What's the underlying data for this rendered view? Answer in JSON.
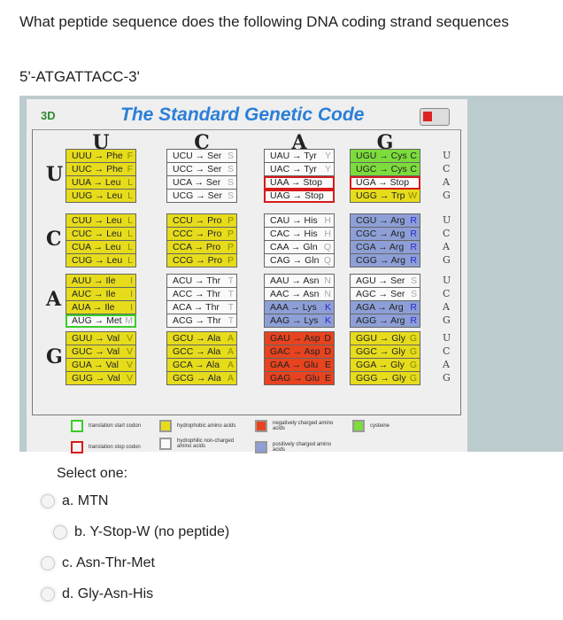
{
  "question": "What peptide sequence does the following DNA coding strand sequences",
  "dna": "5'-ATGATTACC-3'",
  "table": {
    "logo": "3D",
    "title": "The Standard Genetic Code",
    "columns": [
      "U",
      "C",
      "A",
      "G"
    ],
    "third": [
      "U",
      "C",
      "A",
      "G"
    ],
    "rows": [
      {
        "first": "U",
        "blocks": [
          [
            [
              "UUU → Phe",
              "F",
              "y"
            ],
            [
              "UUC → Phe",
              "F",
              "y"
            ],
            [
              "UUA → Leu",
              "L",
              "y"
            ],
            [
              "UUG → Leu",
              "L",
              "y"
            ]
          ],
          [
            [
              "UCU → Ser",
              "S",
              "w"
            ],
            [
              "UCC → Ser",
              "S",
              "w"
            ],
            [
              "UCA → Ser",
              "S",
              "w"
            ],
            [
              "UCG → Ser",
              "S",
              "w"
            ]
          ],
          [
            [
              "UAU → Tyr",
              "Y",
              "w"
            ],
            [
              "UAC → Tyr",
              "Y",
              "w"
            ],
            [
              "UAA → Stop",
              "",
              "w stop"
            ],
            [
              "UAG → Stop",
              "",
              "w stop"
            ]
          ],
          [
            [
              "UGU → Cys",
              "C",
              "g"
            ],
            [
              "UGC → Cys",
              "C",
              "g"
            ],
            [
              "UGA → Stop",
              "",
              "w stop"
            ],
            [
              "UGG → Trp",
              "W",
              "y"
            ]
          ]
        ]
      },
      {
        "first": "C",
        "blocks": [
          [
            [
              "CUU → Leu",
              "L",
              "y"
            ],
            [
              "CUC → Leu",
              "L",
              "y"
            ],
            [
              "CUA → Leu",
              "L",
              "y"
            ],
            [
              "CUG → Leu",
              "L",
              "y"
            ]
          ],
          [
            [
              "CCU → Pro",
              "P",
              "y"
            ],
            [
              "CCC → Pro",
              "P",
              "y"
            ],
            [
              "CCA → Pro",
              "P",
              "y"
            ],
            [
              "CCG → Pro",
              "P",
              "y"
            ]
          ],
          [
            [
              "CAU → His",
              "H",
              "w"
            ],
            [
              "CAC → His",
              "H",
              "w"
            ],
            [
              "CAA → Gln",
              "Q",
              "w"
            ],
            [
              "CAG → Gln",
              "Q",
              "w"
            ]
          ],
          [
            [
              "CGU → Arg",
              "R",
              "b"
            ],
            [
              "CGC → Arg",
              "R",
              "b"
            ],
            [
              "CGA → Arg",
              "R",
              "b"
            ],
            [
              "CGG → Arg",
              "R",
              "b"
            ]
          ]
        ]
      },
      {
        "first": "A",
        "blocks": [
          [
            [
              "AUU → Ile",
              "I",
              "y"
            ],
            [
              "AUC → Ile",
              "I",
              "y"
            ],
            [
              "AUA → Ile",
              "I",
              "y"
            ],
            [
              "AUG → Met",
              "M",
              "w start"
            ]
          ],
          [
            [
              "ACU → Thr",
              "T",
              "w"
            ],
            [
              "ACC → Thr",
              "T",
              "w"
            ],
            [
              "ACA → Thr",
              "T",
              "w"
            ],
            [
              "ACG → Thr",
              "T",
              "w"
            ]
          ],
          [
            [
              "AAU → Asn",
              "N",
              "w"
            ],
            [
              "AAC → Asn",
              "N",
              "w"
            ],
            [
              "AAA → Lys",
              "K",
              "b"
            ],
            [
              "AAG → Lys",
              "K",
              "b"
            ]
          ],
          [
            [
              "AGU → Ser",
              "S",
              "w"
            ],
            [
              "AGC → Ser",
              "S",
              "w"
            ],
            [
              "AGA → Arg",
              "R",
              "b"
            ],
            [
              "AGG → Arg",
              "R",
              "b"
            ]
          ]
        ]
      },
      {
        "first": "G",
        "blocks": [
          [
            [
              "GUU → Val",
              "V",
              "y"
            ],
            [
              "GUC → Val",
              "V",
              "y"
            ],
            [
              "GUA → Val",
              "V",
              "y"
            ],
            [
              "GUG → Val",
              "V",
              "y"
            ]
          ],
          [
            [
              "GCU → Ala",
              "A",
              "y"
            ],
            [
              "GCC → Ala",
              "A",
              "y"
            ],
            [
              "GCA → Ala",
              "A",
              "y"
            ],
            [
              "GCG → Ala",
              "A",
              "y"
            ]
          ],
          [
            [
              "GAU → Asp",
              "D",
              "r"
            ],
            [
              "GAC → Asp",
              "D",
              "r"
            ],
            [
              "GAA → Glu",
              "E",
              "r"
            ],
            [
              "GAG → Glu",
              "E",
              "r"
            ]
          ],
          [
            [
              "GGU → Gly",
              "G",
              "y"
            ],
            [
              "GGC → Gly",
              "G",
              "y"
            ],
            [
              "GGA → Gly",
              "G",
              "y"
            ],
            [
              "GGG → Gly",
              "G",
              "y"
            ]
          ]
        ]
      }
    ],
    "legend": [
      {
        "label": "translation start codon",
        "color": "#3bcc2a",
        "fill": "#f4f4f4"
      },
      {
        "label": "translation stop codon",
        "color": "#d81a1a",
        "fill": "#f4f4f4"
      },
      {
        "label": "hydrophobic amino acids",
        "color": "#999999",
        "fill": "#e6dc1c"
      },
      {
        "label": "hydrophilic non-charged amino acids",
        "color": "#999999",
        "fill": "#fafafa"
      },
      {
        "label": "negatively charged amino acids",
        "color": "#999999",
        "fill": "#e7431f"
      },
      {
        "label": "positively charged amino acids",
        "color": "#999999",
        "fill": "#8d9fd6"
      },
      {
        "label": "cysteine",
        "color": "#999999",
        "fill": "#7cdc3c"
      }
    ]
  },
  "select_label": "Select one:",
  "options": [
    "a. MTN",
    "b. Y-Stop-W (no peptide)",
    "c. Asn-Thr-Met",
    "d. Gly-Asn-His"
  ]
}
